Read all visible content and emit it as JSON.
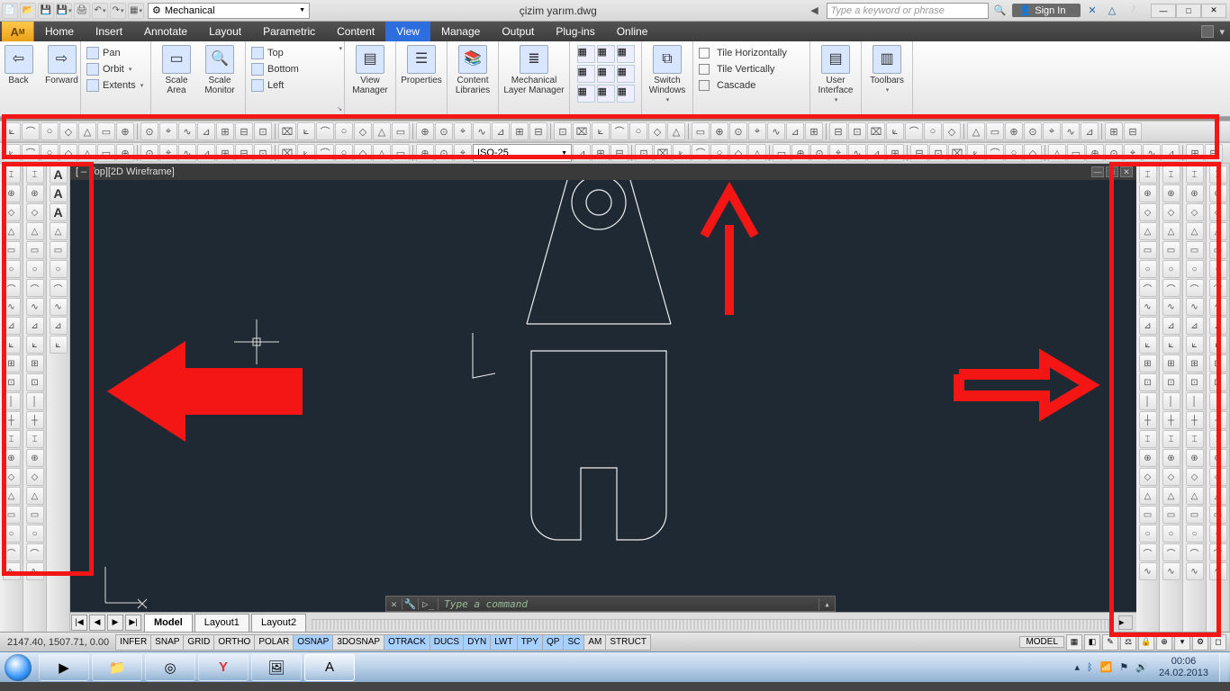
{
  "title_doc": "çizim yarım.dwg",
  "workspace": "Mechanical",
  "search_placeholder": "Type a keyword or phrase",
  "signin_label": "Sign In",
  "menu_tabs": [
    "Home",
    "Insert",
    "Annotate",
    "Layout",
    "Parametric",
    "Content",
    "View",
    "Manage",
    "Output",
    "Plug-ins",
    "Online"
  ],
  "active_menu": "View",
  "ribbon": {
    "nav": {
      "back": "Back",
      "forward": "Forward",
      "pan": "Pan",
      "orbit": "Orbit",
      "extents": "Extents"
    },
    "scale": {
      "area": "Scale\nArea",
      "monitor": "Scale\nMonitor"
    },
    "model": {
      "top": "Top",
      "bottom": "Bottom",
      "left": "Left"
    },
    "viewmgr": "View\nManager",
    "props": "Properties",
    "content": "Content\nLibraries",
    "layermgr": "Mechanical\nLayer Manager",
    "switch": "Switch\nWindows",
    "tile_h": "Tile Horizontally",
    "tile_v": "Tile Vertically",
    "cascade": "Cascade",
    "ui": "User\nInterface",
    "toolbars": "Toolbars"
  },
  "dimstyle": "ISO-25",
  "viewport_label": "[ – Top][2D Wireframe]",
  "cmd_placeholder": "Type a command",
  "layout_tabs": [
    "Model",
    "Layout1",
    "Layout2"
  ],
  "active_layout": "Model",
  "coords": "2147.40, 1507.71, 0.00",
  "status_toggles": [
    "INFER",
    "SNAP",
    "GRID",
    "ORTHO",
    "POLAR",
    "OSNAP",
    "3DOSNAP",
    "OTRACK",
    "DUCS",
    "DYN",
    "LWT",
    "TPY",
    "QP",
    "SC",
    "AM",
    "STRUCT"
  ],
  "status_on": [
    "OSNAP",
    "OTRACK",
    "DUCS",
    "DYN",
    "LWT",
    "TPY",
    "QP",
    "SC"
  ],
  "model_btn": "MODEL",
  "clock_time": "00:06",
  "clock_date": "24.02.2013"
}
